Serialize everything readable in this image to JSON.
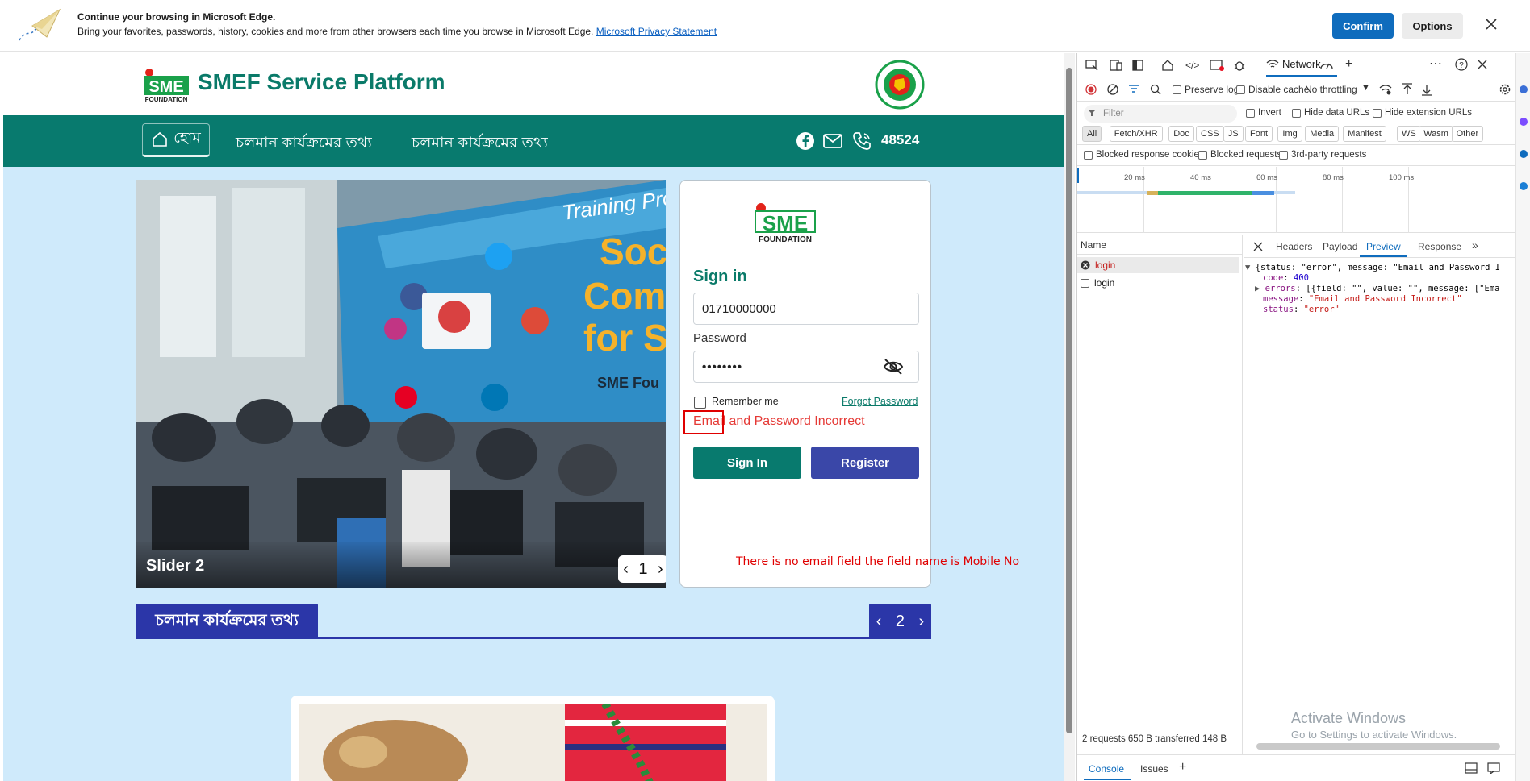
{
  "infobar": {
    "title": "Continue your browsing in Microsoft Edge.",
    "text": "Bring your favorites, passwords, history, cookies and more from other browsers each time you browse in Microsoft Edge.",
    "link": "Microsoft Privacy Statement",
    "confirm": "Confirm",
    "options": "Options"
  },
  "site": {
    "title": "SMEF Service Platform",
    "logo_letters": "SME",
    "logo_sub": "FOUNDATION",
    "nav": {
      "home": "হোম",
      "item1": "চলমান কার্যক্রমের তথ্য",
      "item2": "চলমান কার্যক্রমের তথ্য",
      "phone": "48524"
    },
    "slider": {
      "caption": "Slider 2",
      "counter": "1",
      "banner_line1": "Training Pro",
      "banner_line2": "Soc",
      "banner_line3": "Comm",
      "banner_line4": "for S",
      "banner_line5": "SME Fou"
    },
    "login": {
      "title": "Sign in",
      "mobile_value": "01710000000",
      "password_label": "Password",
      "password_value": "••••••••",
      "remember": "Remember me",
      "forgot": "Forgot Password",
      "error": "Email and Password Incorrect",
      "signin_button": "Sign In",
      "register_button": "Register"
    },
    "annotation": "There is no email field the field name is Mobile No",
    "section": {
      "title": "চলমান কার্যক্রমের তথ্য",
      "page": "2"
    }
  },
  "devtools": {
    "network_tab": "Network",
    "preserve_log": "Preserve log",
    "disable_cache": "Disable cache",
    "throttling": "No throttling",
    "filter_placeholder": "Filter",
    "invert": "Invert",
    "hide_data_urls": "Hide data URLs",
    "hide_extension_urls": "Hide extension URLs",
    "chips": [
      "All",
      "Fetch/XHR",
      "Doc",
      "CSS",
      "JS",
      "Font",
      "Img",
      "Media",
      "Manifest",
      "WS",
      "Wasm",
      "Other"
    ],
    "blocked_cookies": "Blocked response cookies",
    "blocked_requests": "Blocked requests",
    "third_party": "3rd-party requests",
    "ticks": [
      "20 ms",
      "40 ms",
      "60 ms",
      "80 ms",
      "100 ms"
    ],
    "name_header": "Name",
    "requests": [
      "login",
      "login"
    ],
    "detail_tabs": [
      "Headers",
      "Payload",
      "Preview",
      "Response"
    ],
    "preview": {
      "line0": "{status: \"error\", message: \"Email and Password I",
      "code_key": "code",
      "code_val": "400",
      "errors_key": "errors",
      "errors_val": "[{field: \"\", value: \"\", message: [\"Ema",
      "message_key": "message",
      "message_val": "\"Email and Password Incorrect\"",
      "status_key": "status",
      "status_val": "\"error\""
    },
    "status_bar": "2 requests  650 B transferred  148 B",
    "activate_title": "Activate Windows",
    "activate_sub": "Go to Settings to activate Windows.",
    "console": "Console",
    "issues": "Issues"
  },
  "colors": {
    "brand_green": "#087a6e",
    "brand_blue": "#2b36a8",
    "error_red": "#e53935",
    "edge_blue": "#0f6cbd"
  }
}
